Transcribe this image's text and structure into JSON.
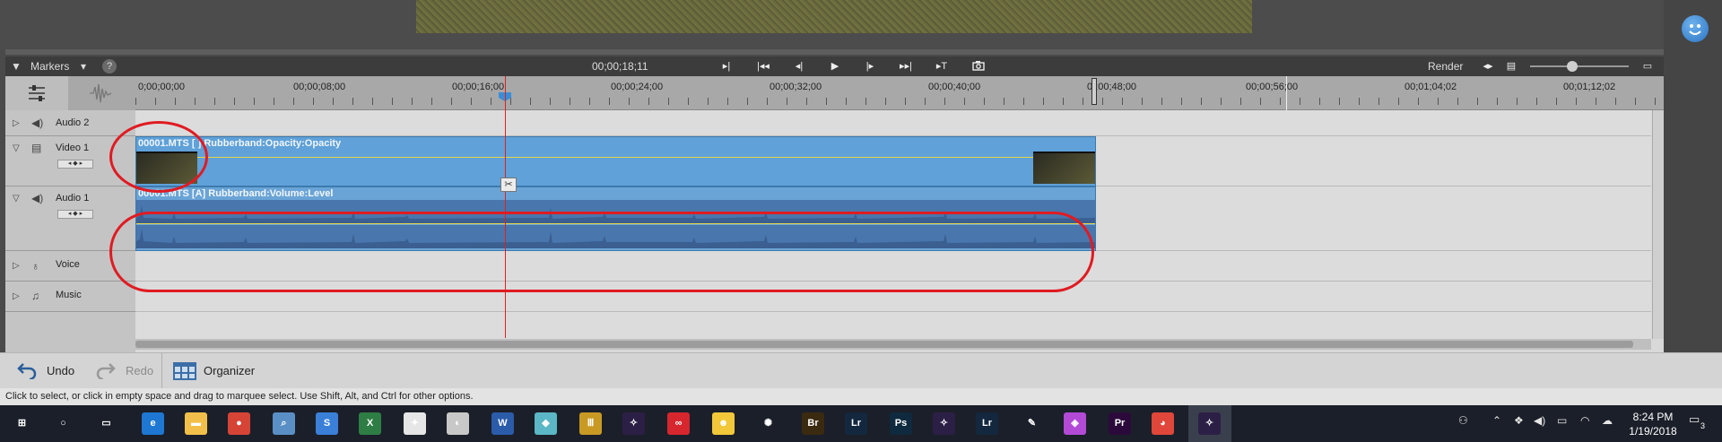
{
  "monitor": {},
  "timeline_toolbar": {
    "markers_label": "Markers",
    "help_label": "?",
    "timecode": "00;00;18;11",
    "render_label": "Render",
    "transport": [
      "▸|",
      "|◂◂",
      "◂|",
      "▶",
      "|▸",
      "▸▸|",
      "▸T"
    ]
  },
  "ruler": {
    "labels": [
      "0;00;00;00",
      "00;00;08;00",
      "00;00;16;00",
      "00;00;24;00",
      "00;00;32;00",
      "00;00;40;00",
      "0 ;00;48;00",
      "00;00;56;00",
      "00;01;04;02",
      "00;01;12;02"
    ]
  },
  "tracks": [
    {
      "name": "Audio 2",
      "icon": "speaker-icon"
    },
    {
      "name": "Video 1",
      "icon": "film-icon"
    },
    {
      "name": "Audio 1",
      "icon": "speaker-icon"
    },
    {
      "name": "Voice",
      "icon": "microphone-icon"
    },
    {
      "name": "Music",
      "icon": "music-note-icon"
    }
  ],
  "clips": {
    "video_title": "00001.MTS [ ] Rubberband:Opacity:Opacity",
    "audio_title": "00001.MTS [A] Rubberband:Volume:Level"
  },
  "actionbar": {
    "undo_label": "Undo",
    "redo_label": "Redo",
    "organizer_label": "Organizer"
  },
  "status_text": "Click to select, or click in empty space and drag to marquee select. Use Shift, Alt, and Ctrl for other options.",
  "taskbar": {
    "clock_time": "8:24 PM",
    "clock_date": "1/19/2018",
    "notification_count": "3",
    "apps": [
      {
        "icon": "windows-start-icon",
        "glyph": "⊞",
        "color": "#1b1f29"
      },
      {
        "icon": "cortana-icon",
        "glyph": "○",
        "color": "#1b1f29"
      },
      {
        "icon": "task-view-icon",
        "glyph": "▭",
        "color": "#1b1f29"
      },
      {
        "icon": "edge-icon",
        "glyph": "e",
        "color": "#1e77d2"
      },
      {
        "icon": "file-explorer-icon",
        "glyph": "▬",
        "color": "#f2c04a"
      },
      {
        "icon": "chrome-icon",
        "glyph": "●",
        "color": "#d64436"
      },
      {
        "icon": "network-search-icon",
        "glyph": "⌕",
        "color": "#5a8fc6"
      },
      {
        "icon": "shazam-icon",
        "glyph": "S",
        "color": "#3a7fd8"
      },
      {
        "icon": "excel-icon",
        "glyph": "X",
        "color": "#2e7d44"
      },
      {
        "icon": "app-icon",
        "glyph": "✦",
        "color": "#e6e6e6"
      },
      {
        "icon": "app-icon",
        "glyph": "◐",
        "color": "#c8c8c8"
      },
      {
        "icon": "word-icon",
        "glyph": "W",
        "color": "#2a5caa"
      },
      {
        "icon": "app-icon",
        "glyph": "◆",
        "color": "#5bb7c5"
      },
      {
        "icon": "app-icon",
        "glyph": "Ⅲ",
        "color": "#c89a24"
      },
      {
        "icon": "premiere-elements-icon",
        "glyph": "✧",
        "color": "#2c1f46"
      },
      {
        "icon": "creative-cloud-icon",
        "glyph": "∞",
        "color": "#d8262f"
      },
      {
        "icon": "app-icon",
        "glyph": "☻",
        "color": "#f2c83a"
      },
      {
        "icon": "lightbulb-icon",
        "glyph": "✺",
        "color": "#1b1f29"
      },
      {
        "icon": "bridge-icon",
        "glyph": "Br",
        "color": "#3a2a10"
      },
      {
        "icon": "lightroom-icon",
        "glyph": "Lr",
        "color": "#13283e"
      },
      {
        "icon": "photoshop-icon",
        "glyph": "Ps",
        "color": "#0f2a3e"
      },
      {
        "icon": "premiere-elements-icon",
        "glyph": "✧",
        "color": "#2c1f46"
      },
      {
        "icon": "lightroom-icon",
        "glyph": "Lr",
        "color": "#13283e"
      },
      {
        "icon": "paint-icon",
        "glyph": "✎",
        "color": "#1b1f29"
      },
      {
        "icon": "map-pin-icon",
        "glyph": "◈",
        "color": "#b24ad6"
      },
      {
        "icon": "premiere-pro-icon",
        "glyph": "Pr",
        "color": "#2b0a3b"
      },
      {
        "icon": "app-icon",
        "glyph": "◕",
        "color": "#e0463a"
      },
      {
        "icon": "premiere-elements-icon",
        "glyph": "✧",
        "color": "#2c1f46"
      }
    ]
  },
  "colors": {
    "annotation_red": "#e01b22",
    "clip_blue": "#5fa1d8",
    "playhead_red": "#e02020"
  }
}
